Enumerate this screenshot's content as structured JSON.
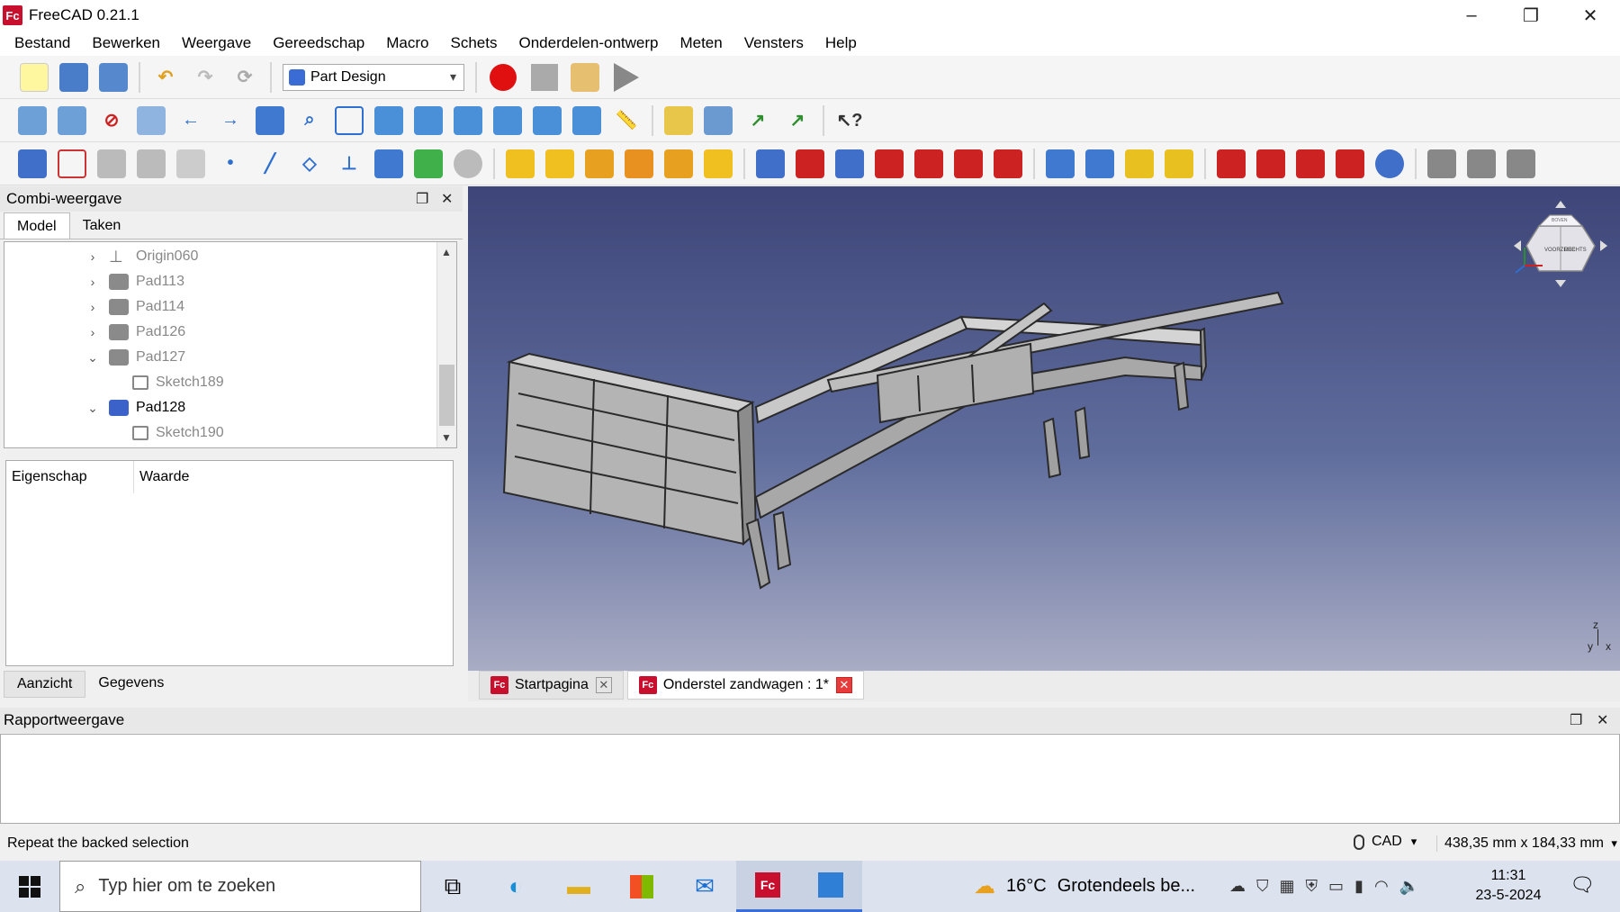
{
  "window": {
    "title": "FreeCAD 0.21.1",
    "logo_text": "Fc",
    "min": "–",
    "max": "❐",
    "close": "✕"
  },
  "menu": [
    "Bestand",
    "Bewerken",
    "Weergave",
    "Gereedschap",
    "Macro",
    "Schets",
    "Onderdelen-ontwerp",
    "Meten",
    "Vensters",
    "Help"
  ],
  "toolbar": {
    "workbench": "Part Design",
    "workbench_arrow": "▾"
  },
  "combi": {
    "title": "Combi-weergave",
    "float": "❐",
    "close": "✕",
    "tabs": [
      "Model",
      "Taken"
    ]
  },
  "tree": [
    {
      "label": "Origin060",
      "expand": "›"
    },
    {
      "label": "Pad113",
      "expand": "›"
    },
    {
      "label": "Pad114",
      "expand": "›"
    },
    {
      "label": "Pad126",
      "expand": "›"
    },
    {
      "label": "Pad127",
      "expand": "⌄"
    },
    {
      "label": "Sketch189",
      "expand": ""
    },
    {
      "label": "Pad128",
      "expand": "⌄"
    },
    {
      "label": "Sketch190",
      "expand": ""
    }
  ],
  "scroll": {
    "up": "▲",
    "down": "▼"
  },
  "properties": {
    "col1": "Eigenschap",
    "col2": "Waarde"
  },
  "bottom_tabs": [
    "Aanzicht",
    "Gegevens"
  ],
  "navcube": {
    "front": "VOORZIJDE",
    "right": "RECHTS",
    "top": "BOVEN"
  },
  "axis": {
    "x": "x",
    "y": "y",
    "z": "z"
  },
  "doc_tabs": [
    {
      "label": "Startpagina",
      "close": "✕"
    },
    {
      "label": "Onderstel zandwagen : 1*",
      "close": "✕"
    }
  ],
  "report": {
    "title": "Rapportweergave",
    "float": "❐",
    "close": "✕"
  },
  "status": {
    "message": "Repeat the backed selection",
    "nav_style": "CAD",
    "nav_arrow": "▾",
    "dimensions": "438,35 mm x 184,33 mm",
    "dim_arrow": "▾"
  },
  "taskbar": {
    "search_placeholder": "Typ hier om te zoeken",
    "weather_temp": "16°C",
    "weather_text": "Grotendeels be...",
    "time": "11:31",
    "date": "23-5-2024"
  },
  "colors": {
    "accent": "#3a62c8",
    "record": "#e01010",
    "freecad": "#c8102e"
  }
}
